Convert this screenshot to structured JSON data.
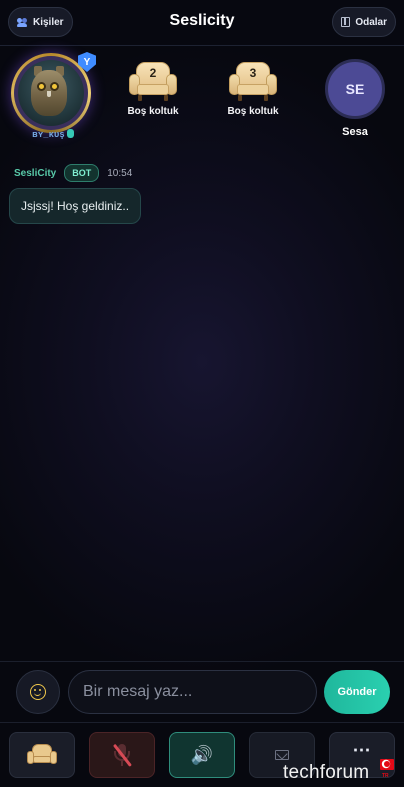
{
  "header": {
    "title": "Seslicity",
    "left_button": "Kişiler",
    "right_button": "Odalar"
  },
  "seats": {
    "host": {
      "name": "ʙʏ_ᴋᴜş",
      "badge": "Y"
    },
    "empty": [
      {
        "number": "2",
        "label": "Boş koltuk"
      },
      {
        "number": "3",
        "label": "Boş koltuk"
      }
    ],
    "user": {
      "initials": "SE",
      "name": "Sesa"
    }
  },
  "chat": {
    "messages": [
      {
        "sender": "SesliCity",
        "badge": "BOT",
        "time": "10:54",
        "text": "Jsjssj! Hoş geldiniz.."
      }
    ]
  },
  "composer": {
    "placeholder": "Bir mesaj yaz...",
    "send_label": "Gönder"
  },
  "toolbar": {
    "items": [
      "seat-icon",
      "mic-muted-icon",
      "speaker-icon",
      "message-icon",
      "more-icon"
    ],
    "more_label": "⋯"
  },
  "watermark": {
    "text": "techforum",
    "flag_text": "TR"
  },
  "colors": {
    "accent": "#2ad0b0",
    "bot_badge": "#7ff0d1",
    "sender": "#58c9a8",
    "mic_muted": "#d64a55"
  }
}
